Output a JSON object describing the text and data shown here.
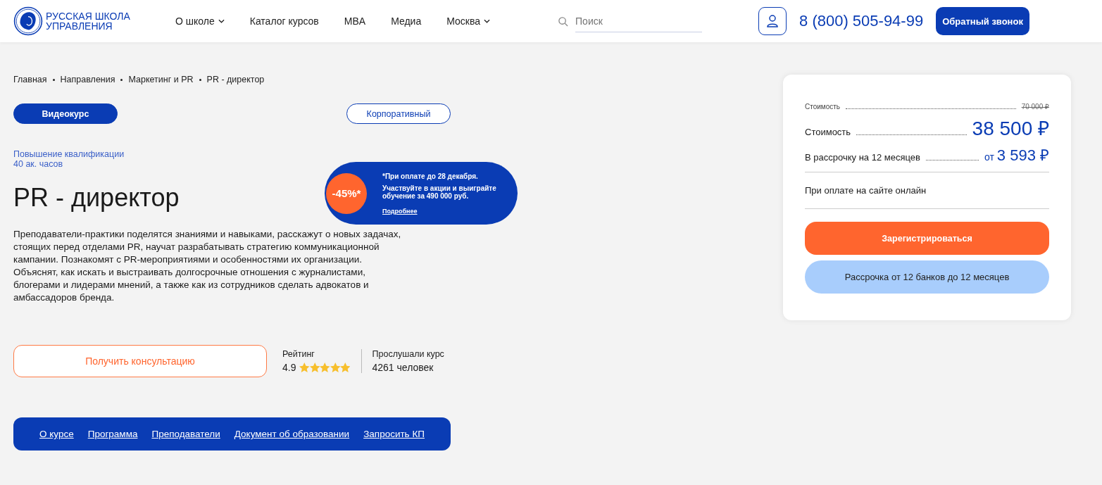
{
  "header": {
    "logo_text": "РУССКАЯ ШКОЛА УПРАВЛЕНИЯ",
    "nav": [
      {
        "label": "О школе",
        "has_menu": true
      },
      {
        "label": "Каталог курсов",
        "has_menu": false
      },
      {
        "label": "MBA",
        "has_menu": false
      },
      {
        "label": "Медиа",
        "has_menu": false
      },
      {
        "label": "Москва",
        "has_menu": true
      }
    ],
    "search": {
      "placeholder": "Поиск"
    },
    "phone": "8 (800) 505-94-99",
    "callback_button": "Обратный звонок"
  },
  "breadcrumbs": [
    "Главная",
    "Направления",
    "Маркетинг и PR",
    "PR - директор"
  ],
  "tabs": [
    {
      "label": "Видеокурс",
      "selected": true
    },
    {
      "label": "Корпоративный",
      "selected": false
    }
  ],
  "category": "Повышение квалификации",
  "hours": "40 ак. часов",
  "title": "PR - директор",
  "promo": {
    "discount": "-45%*",
    "deadline": "*При оплате до 28 декабря.",
    "text": "Участвуйте в акции и выиграйте обучение за 490 000 руб.",
    "link": "Подробнее"
  },
  "description": "Преподаватели-практики поделятся знаниями и навыками, расскажут о новых задачах, стоящих перед отделами PR, научат разрабатывать стратегию коммуникационной кампании. Познакомят с PR-мероприятиями и особенностями их организации. Объяснят, как искать и выстраивать долгосрочные отношения с журналистами, блогерами и лидерами мнений, а также как из сотрудников сделать адвокатов и амбассадоров бренда.",
  "consult_button": "Получить консультацию",
  "rating": {
    "label": "Рейтинг",
    "value": "4.9",
    "stars": 4.9
  },
  "listeners": {
    "label": "Прослушали курс",
    "value": "4261 человек"
  },
  "anchors": [
    "О курсе",
    "Программа",
    "Преподаватели",
    "Документ об образовании",
    "Запросить КП"
  ],
  "price_card": {
    "old": {
      "label": "Стоимость",
      "value": "70 000 ₽"
    },
    "current": {
      "label": "Стоимость",
      "value": "38 500 ₽"
    },
    "installment": {
      "label": "В рассрочку на 12 месяцев",
      "prefix": "от",
      "value": "3 593 ₽"
    },
    "note": "При оплате на сайте онлайн",
    "register_button": "Зарегистрироваться",
    "credit_button": "Рассрочка от 12 банков до 12 месяцев"
  }
}
